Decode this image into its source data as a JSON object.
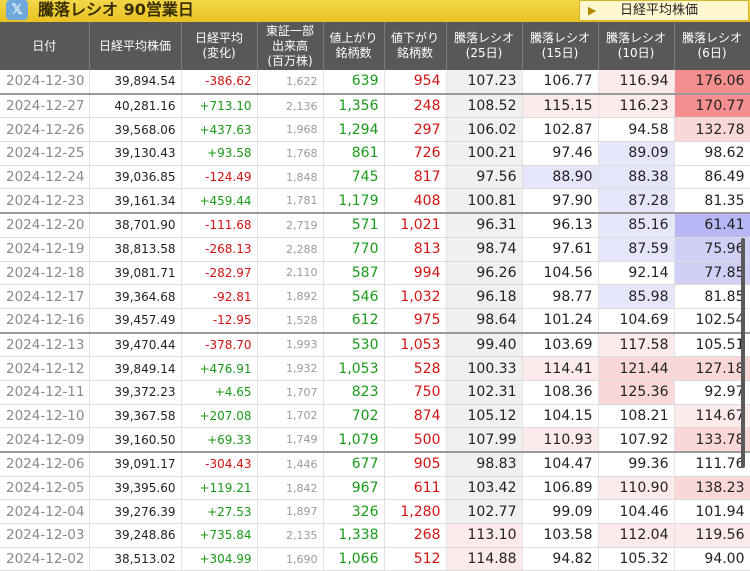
{
  "header": {
    "x_icon": "x-logo-icon",
    "title": "騰落レシオ 90営業日",
    "link_label": "日経平均株価",
    "link_arrow": "▶"
  },
  "colors": {
    "hot_strong": "#f58f8f",
    "hot_mid": "#f8b3b3",
    "hot_light": "#fbd8d8",
    "hot_faint": "#fdeaea",
    "cold_strong": "#b7b7f5",
    "cold_mid": "#d0d0f7",
    "cold_light": "#e6e6fb",
    "neutral": "#f0f0f0"
  },
  "columns": [
    "日付",
    "日経平均株価",
    "日経平均\n(変化)",
    "東証一部\n出来高\n(百万株)",
    "値上がり\n銘柄数",
    "値下がり\n銘柄数",
    "騰落レシオ\n(25日)",
    "騰落レシオ\n(15日)",
    "騰落レシオ\n(10日)",
    "騰落レシオ\n(6日)"
  ],
  "rows": [
    {
      "date": "2024-12-30",
      "avg": "39,894.54",
      "chg": "-386.62",
      "vol": "1,622",
      "up": "639",
      "down": "954",
      "r25": "107.23",
      "r15": "106.77",
      "r10": "116.94",
      "r6": "176.06",
      "c25": "neutral",
      "c15": "none",
      "c10": "hot_faint",
      "c6": "hot_strong",
      "week": false
    },
    {
      "date": "2024-12-27",
      "avg": "40,281.16",
      "chg": "+713.10",
      "vol": "2,136",
      "up": "1,356",
      "down": "248",
      "r25": "108.52",
      "r15": "115.15",
      "r10": "116.23",
      "r6": "170.77",
      "c25": "neutral",
      "c15": "hot_faint",
      "c10": "hot_faint",
      "c6": "hot_strong",
      "week": true
    },
    {
      "date": "2024-12-26",
      "avg": "39,568.06",
      "chg": "+437.63",
      "vol": "1,968",
      "up": "1,294",
      "down": "297",
      "r25": "106.02",
      "r15": "102.87",
      "r10": "94.58",
      "r6": "132.78",
      "c25": "neutral",
      "c15": "none",
      "c10": "none",
      "c6": "hot_light",
      "week": false
    },
    {
      "date": "2024-12-25",
      "avg": "39,130.43",
      "chg": "+93.58",
      "vol": "1,768",
      "up": "861",
      "down": "726",
      "r25": "100.21",
      "r15": "97.46",
      "r10": "89.09",
      "r6": "98.62",
      "c25": "neutral",
      "c15": "none",
      "c10": "cold_light",
      "c6": "none",
      "week": false
    },
    {
      "date": "2024-12-24",
      "avg": "39,036.85",
      "chg": "-124.49",
      "vol": "1,848",
      "up": "745",
      "down": "817",
      "r25": "97.56",
      "r15": "88.90",
      "r10": "88.38",
      "r6": "86.49",
      "c25": "neutral",
      "c15": "cold_light",
      "c10": "cold_light",
      "c6": "none",
      "week": false
    },
    {
      "date": "2024-12-23",
      "avg": "39,161.34",
      "chg": "+459.44",
      "vol": "1,781",
      "up": "1,179",
      "down": "408",
      "r25": "100.81",
      "r15": "97.90",
      "r10": "87.28",
      "r6": "81.35",
      "c25": "neutral",
      "c15": "none",
      "c10": "cold_light",
      "c6": "none",
      "week": false
    },
    {
      "date": "2024-12-20",
      "avg": "38,701.90",
      "chg": "-111.68",
      "vol": "2,719",
      "up": "571",
      "down": "1,021",
      "r25": "96.31",
      "r15": "96.13",
      "r10": "85.16",
      "r6": "61.41",
      "c25": "neutral",
      "c15": "none",
      "c10": "cold_light",
      "c6": "cold_strong",
      "week": true
    },
    {
      "date": "2024-12-19",
      "avg": "38,813.58",
      "chg": "-268.13",
      "vol": "2,288",
      "up": "770",
      "down": "813",
      "r25": "98.74",
      "r15": "97.61",
      "r10": "87.59",
      "r6": "75.96",
      "c25": "neutral",
      "c15": "none",
      "c10": "cold_light",
      "c6": "cold_mid",
      "week": false
    },
    {
      "date": "2024-12-18",
      "avg": "39,081.71",
      "chg": "-282.97",
      "vol": "2,110",
      "up": "587",
      "down": "994",
      "r25": "96.26",
      "r15": "104.56",
      "r10": "92.14",
      "r6": "77.85",
      "c25": "neutral",
      "c15": "none",
      "c10": "none",
      "c6": "cold_mid",
      "week": false
    },
    {
      "date": "2024-12-17",
      "avg": "39,364.68",
      "chg": "-92.81",
      "vol": "1,892",
      "up": "546",
      "down": "1,032",
      "r25": "96.18",
      "r15": "98.77",
      "r10": "85.98",
      "r6": "81.85",
      "c25": "neutral",
      "c15": "none",
      "c10": "cold_light",
      "c6": "none",
      "week": false
    },
    {
      "date": "2024-12-16",
      "avg": "39,457.49",
      "chg": "-12.95",
      "vol": "1,528",
      "up": "612",
      "down": "975",
      "r25": "98.64",
      "r15": "101.24",
      "r10": "104.69",
      "r6": "102.54",
      "c25": "neutral",
      "c15": "none",
      "c10": "none",
      "c6": "none",
      "week": false
    },
    {
      "date": "2024-12-13",
      "avg": "39,470.44",
      "chg": "-378.70",
      "vol": "1,993",
      "up": "530",
      "down": "1,053",
      "r25": "99.40",
      "r15": "103.69",
      "r10": "117.58",
      "r6": "105.51",
      "c25": "neutral",
      "c15": "none",
      "c10": "hot_faint",
      "c6": "none",
      "week": true
    },
    {
      "date": "2024-12-12",
      "avg": "39,849.14",
      "chg": "+476.91",
      "vol": "1,932",
      "up": "1,053",
      "down": "528",
      "r25": "100.33",
      "r15": "114.41",
      "r10": "121.44",
      "r6": "127.18",
      "c25": "neutral",
      "c15": "hot_faint",
      "c10": "hot_light",
      "c6": "hot_light",
      "week": false
    },
    {
      "date": "2024-12-11",
      "avg": "39,372.23",
      "chg": "+4.65",
      "vol": "1,707",
      "up": "823",
      "down": "750",
      "r25": "102.31",
      "r15": "108.36",
      "r10": "125.36",
      "r6": "92.97",
      "c25": "neutral",
      "c15": "none",
      "c10": "hot_light",
      "c6": "none",
      "week": false
    },
    {
      "date": "2024-12-10",
      "avg": "39,367.58",
      "chg": "+207.08",
      "vol": "1,702",
      "up": "702",
      "down": "874",
      "r25": "105.12",
      "r15": "104.15",
      "r10": "108.21",
      "r6": "114.67",
      "c25": "neutral",
      "c15": "none",
      "c10": "none",
      "c6": "hot_faint",
      "week": false
    },
    {
      "date": "2024-12-09",
      "avg": "39,160.50",
      "chg": "+69.33",
      "vol": "1,749",
      "up": "1,079",
      "down": "500",
      "r25": "107.99",
      "r15": "110.93",
      "r10": "107.92",
      "r6": "133.78",
      "c25": "neutral",
      "c15": "hot_faint",
      "c10": "none",
      "c6": "hot_light",
      "week": false
    },
    {
      "date": "2024-12-06",
      "avg": "39,091.17",
      "chg": "-304.43",
      "vol": "1,446",
      "up": "677",
      "down": "905",
      "r25": "98.83",
      "r15": "104.47",
      "r10": "99.36",
      "r6": "111.76",
      "c25": "neutral",
      "c15": "none",
      "c10": "none",
      "c6": "none",
      "week": true
    },
    {
      "date": "2024-12-05",
      "avg": "39,395.60",
      "chg": "+119.21",
      "vol": "1,842",
      "up": "967",
      "down": "611",
      "r25": "103.42",
      "r15": "106.89",
      "r10": "110.90",
      "r6": "138.23",
      "c25": "neutral",
      "c15": "none",
      "c10": "hot_faint",
      "c6": "hot_light",
      "week": false
    },
    {
      "date": "2024-12-04",
      "avg": "39,276.39",
      "chg": "+27.53",
      "vol": "1,897",
      "up": "326",
      "down": "1,280",
      "r25": "102.77",
      "r15": "99.09",
      "r10": "104.46",
      "r6": "101.94",
      "c25": "neutral",
      "c15": "none",
      "c10": "none",
      "c6": "none",
      "week": false
    },
    {
      "date": "2024-12-03",
      "avg": "39,248.86",
      "chg": "+735.84",
      "vol": "2,135",
      "up": "1,338",
      "down": "268",
      "r25": "113.10",
      "r15": "103.58",
      "r10": "112.04",
      "r6": "119.56",
      "c25": "hot_faint",
      "c15": "none",
      "c10": "hot_faint",
      "c6": "hot_faint",
      "week": false
    },
    {
      "date": "2024-12-02",
      "avg": "38,513.02",
      "chg": "+304.99",
      "vol": "1,690",
      "up": "1,066",
      "down": "512",
      "r25": "114.88",
      "r15": "94.82",
      "r10": "105.32",
      "r6": "94.00",
      "c25": "hot_faint",
      "c15": "none",
      "c10": "none",
      "c6": "none",
      "week": false
    }
  ]
}
